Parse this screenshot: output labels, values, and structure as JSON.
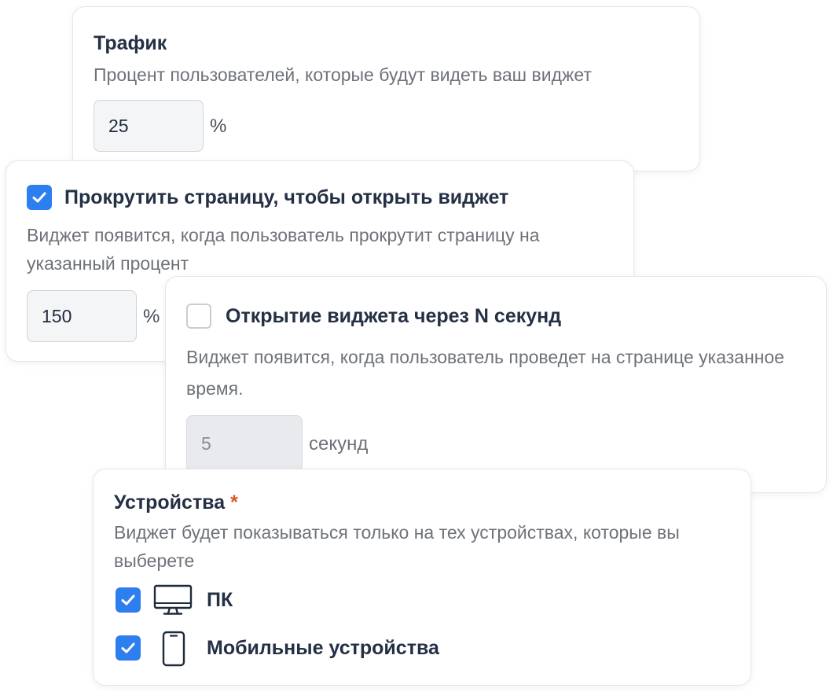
{
  "traffic": {
    "title": "Трафик",
    "description": "Процент пользователей, которые будут видеть ваш виджет",
    "value": "25",
    "unit": "%"
  },
  "scroll": {
    "checked": true,
    "title": "Прокрутить страницу, чтобы открыть виджет",
    "description": "Виджет появится, когда пользователь прокрутит страницу на указанный процент",
    "value": "150",
    "unit": "%"
  },
  "delay": {
    "checked": false,
    "title": "Открытие виджета через N секунд",
    "description": "Виджет появится, когда пользователь проведет на странице указанное время.",
    "value": "5",
    "unit": "секунд"
  },
  "devices": {
    "title": "Устройства",
    "required_mark": "*",
    "description": "Виджет будет показываться только на тех устройствах, которые вы выберете",
    "items": [
      {
        "label": "ПК",
        "icon": "desktop-icon",
        "checked": true
      },
      {
        "label": "Мобильные устройства",
        "icon": "mobile-phone-icon",
        "checked": true
      }
    ]
  },
  "colors": {
    "accent": "#2d7ff0",
    "required": "#d9591c"
  }
}
